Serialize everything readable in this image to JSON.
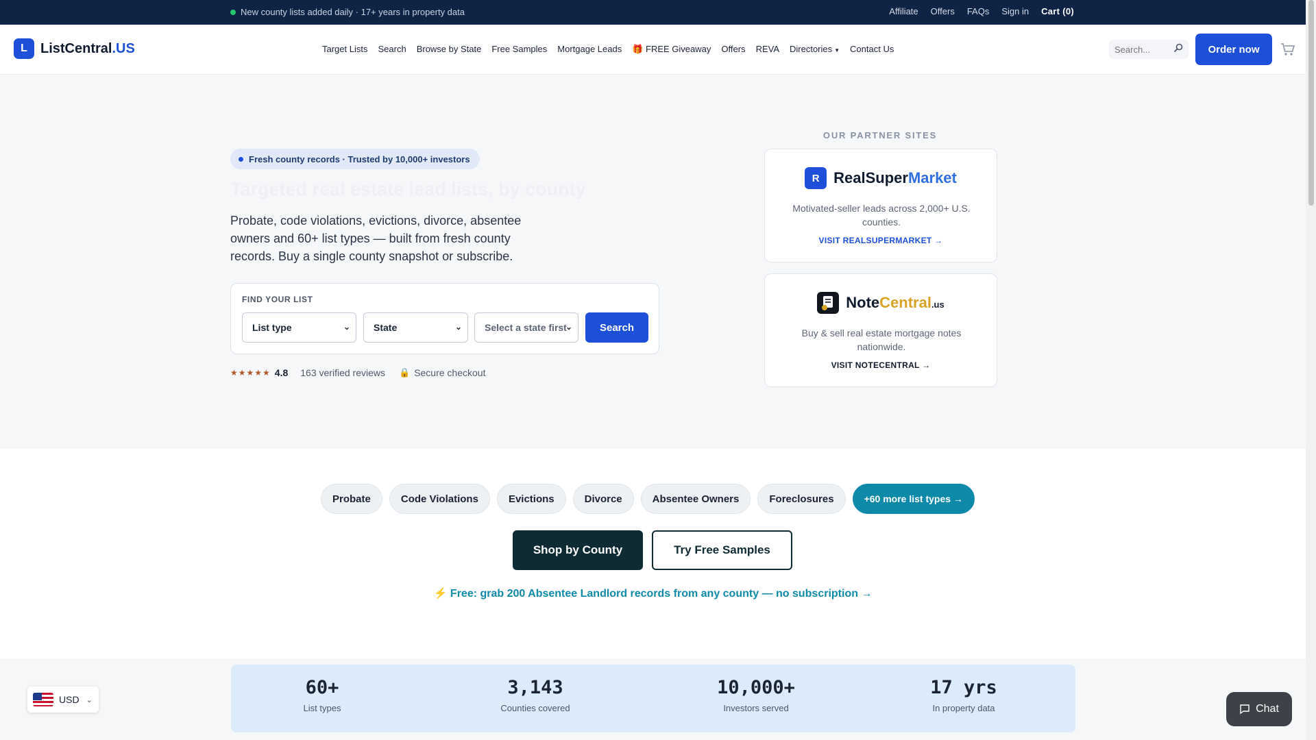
{
  "topbar": {
    "announcement": "New county lists added daily · 17+ years in property data",
    "links": [
      "Affiliate",
      "Offers",
      "FAQs",
      "Sign in"
    ],
    "cart": "Cart (0)"
  },
  "header": {
    "logo_mark": "L",
    "logo_name": "ListCentral",
    "logo_tld": ".US",
    "nav": [
      "Target Lists",
      "Search",
      "Browse by State",
      "Free Samples",
      "Mortgage Leads",
      "🎁 FREE Giveaway",
      "Offers",
      "REVA",
      "Directories",
      "Contact Us"
    ],
    "search_placeholder": "Search...",
    "order_button": "Order now"
  },
  "hero": {
    "pill": "Fresh county records · Trusted by 10,000+ investors",
    "title": "Targeted real estate lead lists, by county",
    "description": "Probate, code violations, evictions, divorce, absentee owners and 60+ list types — built from fresh county records. Buy a single county snapshot or subscribe.",
    "find_label": "FIND YOUR LIST",
    "select_list_type": "List type",
    "select_state": "State",
    "select_county": "Select a state first",
    "search_button": "Search",
    "stars": "★★★★★",
    "rating": "4.8",
    "reviews": "163 verified reviews",
    "secure": "Secure checkout"
  },
  "partners": {
    "heading": "OUR PARTNER SITES",
    "one": {
      "mark": "R",
      "name_a": "RealSuper",
      "name_b": "Market",
      "description": "Motivated-seller leads across 2,000+ U.S. counties.",
      "link": "VISIT REALSUPERMARKET →"
    },
    "two": {
      "name_a": "Note",
      "name_b": "Central",
      "name_c": ".us",
      "description": "Buy & sell real estate mortgage notes nationwide.",
      "link": "VISIT NOTECENTRAL →"
    }
  },
  "list_types": [
    "Probate",
    "Code Violations",
    "Evictions",
    "Divorce",
    "Absentee Owners",
    "Foreclosures"
  ],
  "more_types": "+60 more list types →",
  "cta": {
    "shop": "Shop by County",
    "samples": "Try Free Samples",
    "free_offer": "⚡ Free: grab 200 Absentee Landlord records from any county — no subscription →"
  },
  "stats": [
    {
      "num": "60+",
      "label": "List types"
    },
    {
      "num": "3,143",
      "label": "Counties covered"
    },
    {
      "num": "10,000+",
      "label": "Investors served"
    },
    {
      "num": "17 yrs",
      "label": "In property data"
    }
  ],
  "currency": "USD",
  "chat": "Chat",
  "colors": {
    "brand": "#1d4fd8",
    "teal": "#0e8aa8",
    "topbar": "#0f2344"
  }
}
